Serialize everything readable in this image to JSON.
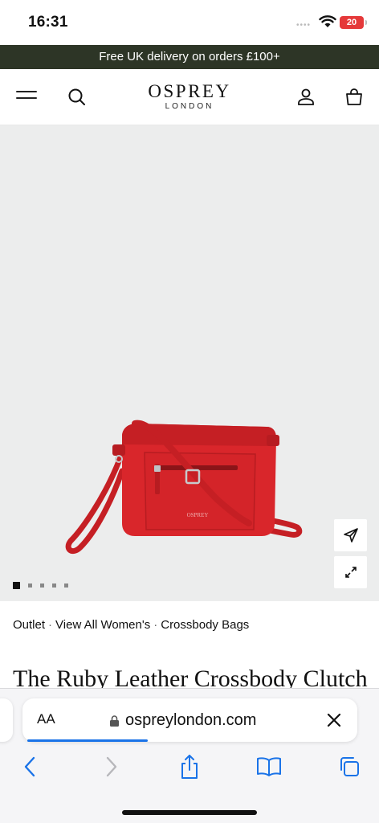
{
  "status_bar": {
    "time": "16:31",
    "battery": "20"
  },
  "promo": {
    "text": "Free UK delivery on orders £100+"
  },
  "header": {
    "logo_main": "OSPREY",
    "logo_sub": "LONDON"
  },
  "gallery": {
    "slide_count": 5,
    "active_slide": 1,
    "bag_logo_text": "OSPREY"
  },
  "breadcrumb": {
    "items": [
      "Outlet",
      "View All Women's",
      "Crossbody Bags"
    ],
    "separator": "·"
  },
  "product": {
    "title": "The Ruby Leather Crossbody Clutch"
  },
  "browser": {
    "reader_label": "AA",
    "url": "ospreylondon.com"
  },
  "colors": {
    "promo_bg": "#2d3526",
    "accent_blue": "#1a73e8",
    "bag_red": "#d9262b",
    "battery_red": "#e5393a"
  }
}
